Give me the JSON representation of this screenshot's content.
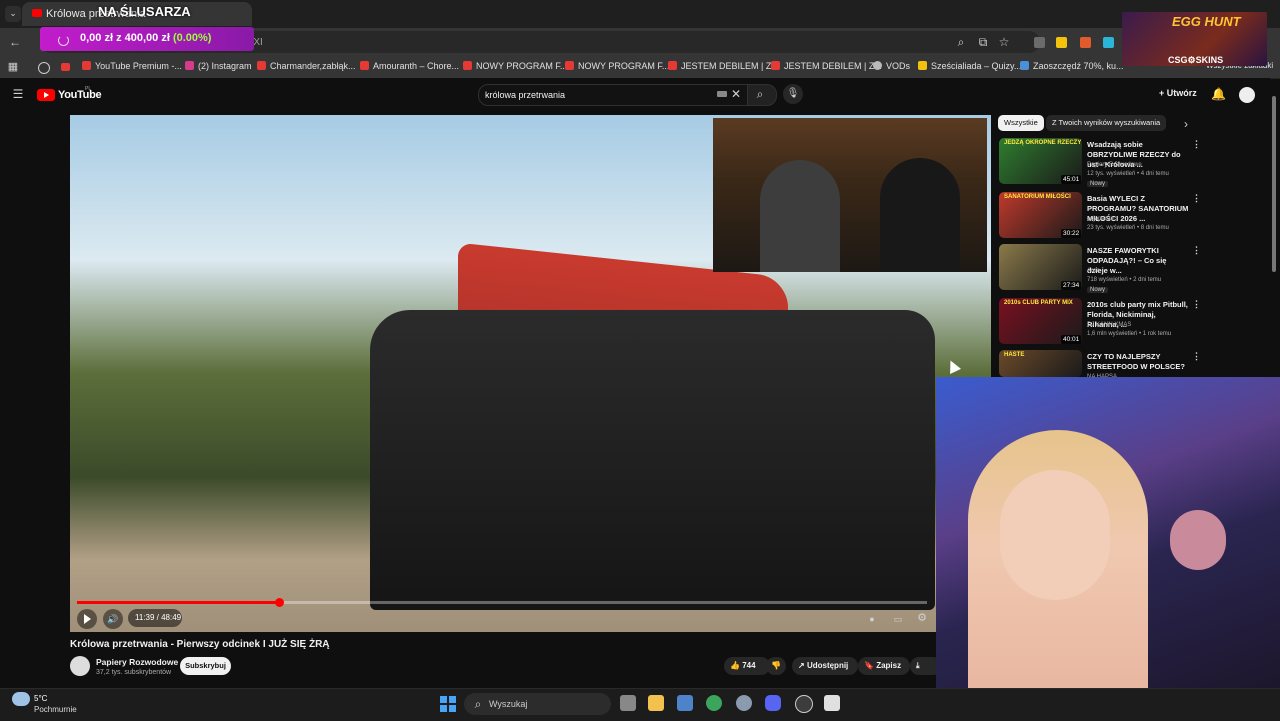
{
  "browser": {
    "tab_title": "Królowa przetrwania",
    "url_fragment": "bQXI",
    "bookmarks": [
      "YouTube Premium -...",
      "(2) Instagram",
      "Charmander,zabłąk...",
      "Amouranth – Chore...",
      "NOWY PROGRAM F...",
      "NOWY PROGRAM F...",
      "JESTEM DEBILEM | Z...",
      "JESTEM DEBILEM | Z...",
      "VODs",
      "Sześcialiada – Quizy...",
      "Zaoszczędź 70%, ku...",
      "Wszystkie zakładki"
    ]
  },
  "overlay": {
    "donate_title": "NA ŚLUSARZA",
    "donate_amount": "0,00 zł z 400,00 zł",
    "donate_pct": "(0.00%)",
    "promo_title": "EGG HUNT",
    "promo_sub": "CSG⚙SKINS"
  },
  "youtube": {
    "logo": "YouTube",
    "logo_region": "PL",
    "search_query": "królowa przetrwania",
    "create_label": "Utwórz",
    "video": {
      "time": "11:39 / 48:49",
      "progress": 0.238,
      "title": "Królowa przetrwania - Pierwszy odcinek I JUŻ SIĘ ŻRĄ",
      "channel": "Papiery Rozwodowe",
      "subscribers": "37,2 tys. subskrybentów",
      "subscribe_label": "Subskrybuj",
      "likes": "744",
      "share_label": "Udostępnij",
      "save_label": "Zapisz"
    },
    "chips": [
      "Wszystkie",
      "Z Twoich wyników wyszukiwania"
    ],
    "recommendations": [
      {
        "title": "Wsadzają sobie OBRZYDLIWE RZECZY do ust - Królowa ...",
        "channel": "Papiery Rozwodowe",
        "meta": "12 tys. wyświetleń • 4 dni temu",
        "badge": "Nowy",
        "duration": "45:01",
        "thumb_text": "JEDZĄ OKROPNE RZECZY",
        "color": "#2f7d2f"
      },
      {
        "title": "Basia WYLECI Z PROGRAMU? SANATORIUM MIŁOŚCI 2026 ...",
        "channel": "cojapacze",
        "meta": "23 tys. wyświetleń • 8 dni temu",
        "badge": "",
        "duration": "30:22",
        "thumb_text": "SANATORIUM MIŁOŚCI",
        "color": "#c0392b"
      },
      {
        "title": "NASZE FAWORYTKI ODPADAJĄ?! – Co się dzieje w...",
        "channel": "Aron",
        "meta": "718 wyświetleń • 2 dni temu",
        "badge": "Nowy",
        "duration": "27:34",
        "thumb_text": "",
        "color": "#8a7a4a"
      },
      {
        "title": "2010s club party mix Pitbull, Florida, Nickiminaj, Rihanna, ...",
        "channel": "DJ KANN XMAS",
        "meta": "1,6 mln wyświetleń • 1 rok temu",
        "badge": "",
        "duration": "40:01",
        "thumb_text": "2010s CLUB PARTY MIX",
        "color": "#7a1020"
      },
      {
        "title": "CZY TO NAJLEPSZY STREETFOOD W POLSCE?",
        "channel": "NA HAPSA",
        "meta": "",
        "badge": "",
        "duration": "",
        "thumb_text": "HASTE",
        "color": "#6b4a2a"
      }
    ]
  },
  "taskbar": {
    "temp": "5°C",
    "weather": "Pochmurnie",
    "search_label": "Wyszukaj"
  },
  "colors": {
    "accent": "#ff0000",
    "donate_bar": "#c21ccb",
    "donate_pct": "#9dff3a"
  }
}
